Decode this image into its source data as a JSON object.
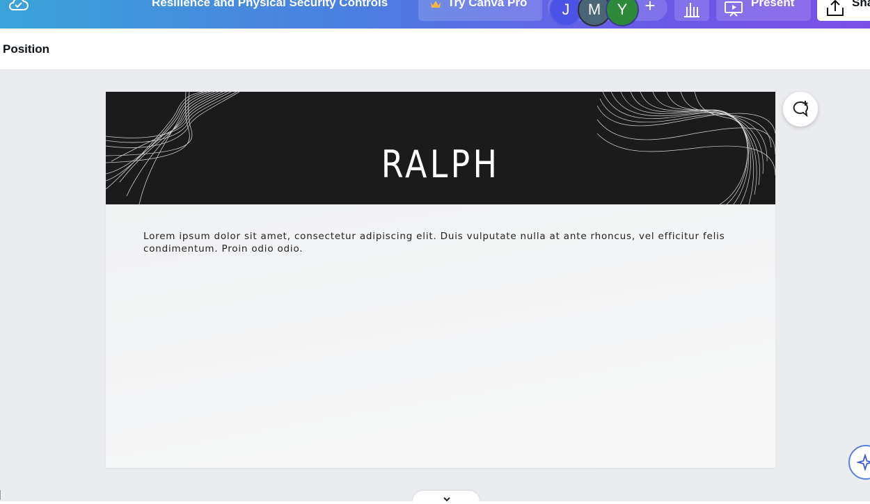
{
  "topbar": {
    "sync_icon": "cloud-check-icon",
    "doc_title": "Resilience and Physical Security Controls",
    "try_pro_label": "Try Canva Pro",
    "collaborators": [
      {
        "initial": "J",
        "color": "#4b52e6"
      },
      {
        "initial": "M",
        "color": "#4a6478"
      },
      {
        "initial": "Y",
        "color": "#2d8a3a"
      }
    ],
    "add_collaborator_label": "+",
    "present_label": "Present",
    "share_label": "Share"
  },
  "contextbar": {
    "position_label": "Position"
  },
  "slide": {
    "title": "RALPH",
    "body": "Lorem ipsum dolor sit amet, consectetur adipiscing elit. Duis vulputate nulla at ante rhoncus, vel efficitur felis condimentum. Proin odio odio."
  },
  "colors": {
    "topbar_gradient_start": "#3aa3d9",
    "topbar_gradient_end": "#7b4fe6",
    "banner": "#1b1b1b",
    "canvas_bg": "#ebecf0"
  }
}
